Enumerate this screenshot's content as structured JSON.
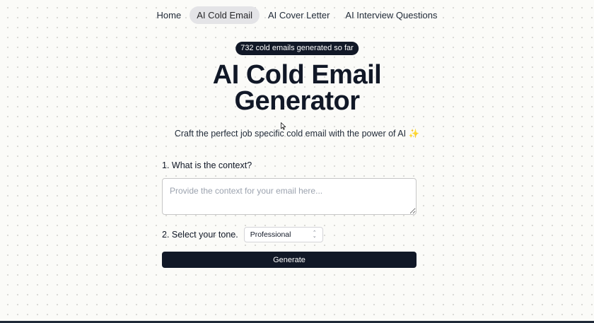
{
  "nav": {
    "items": [
      {
        "label": "Home"
      },
      {
        "label": "AI Cold Email",
        "active": true
      },
      {
        "label": "AI Cover Letter"
      },
      {
        "label": "AI Interview Questions"
      }
    ]
  },
  "hero": {
    "counter": "732 cold emails generated so far",
    "title_line1": "AI Cold Email",
    "title_line2": "Generator",
    "subtitle": "Craft the perfect job specific cold email with the power of AI ✨"
  },
  "form": {
    "context_label": "1. What is the context?",
    "context_placeholder": "Provide the context for your email here...",
    "context_value": "",
    "tone_label": "2. Select your tone.",
    "tone_value": "Professional",
    "generate_label": "Generate"
  },
  "colors": {
    "primary": "#111827",
    "background": "#fbfbf8",
    "nav_active": "#e4e4e7"
  }
}
